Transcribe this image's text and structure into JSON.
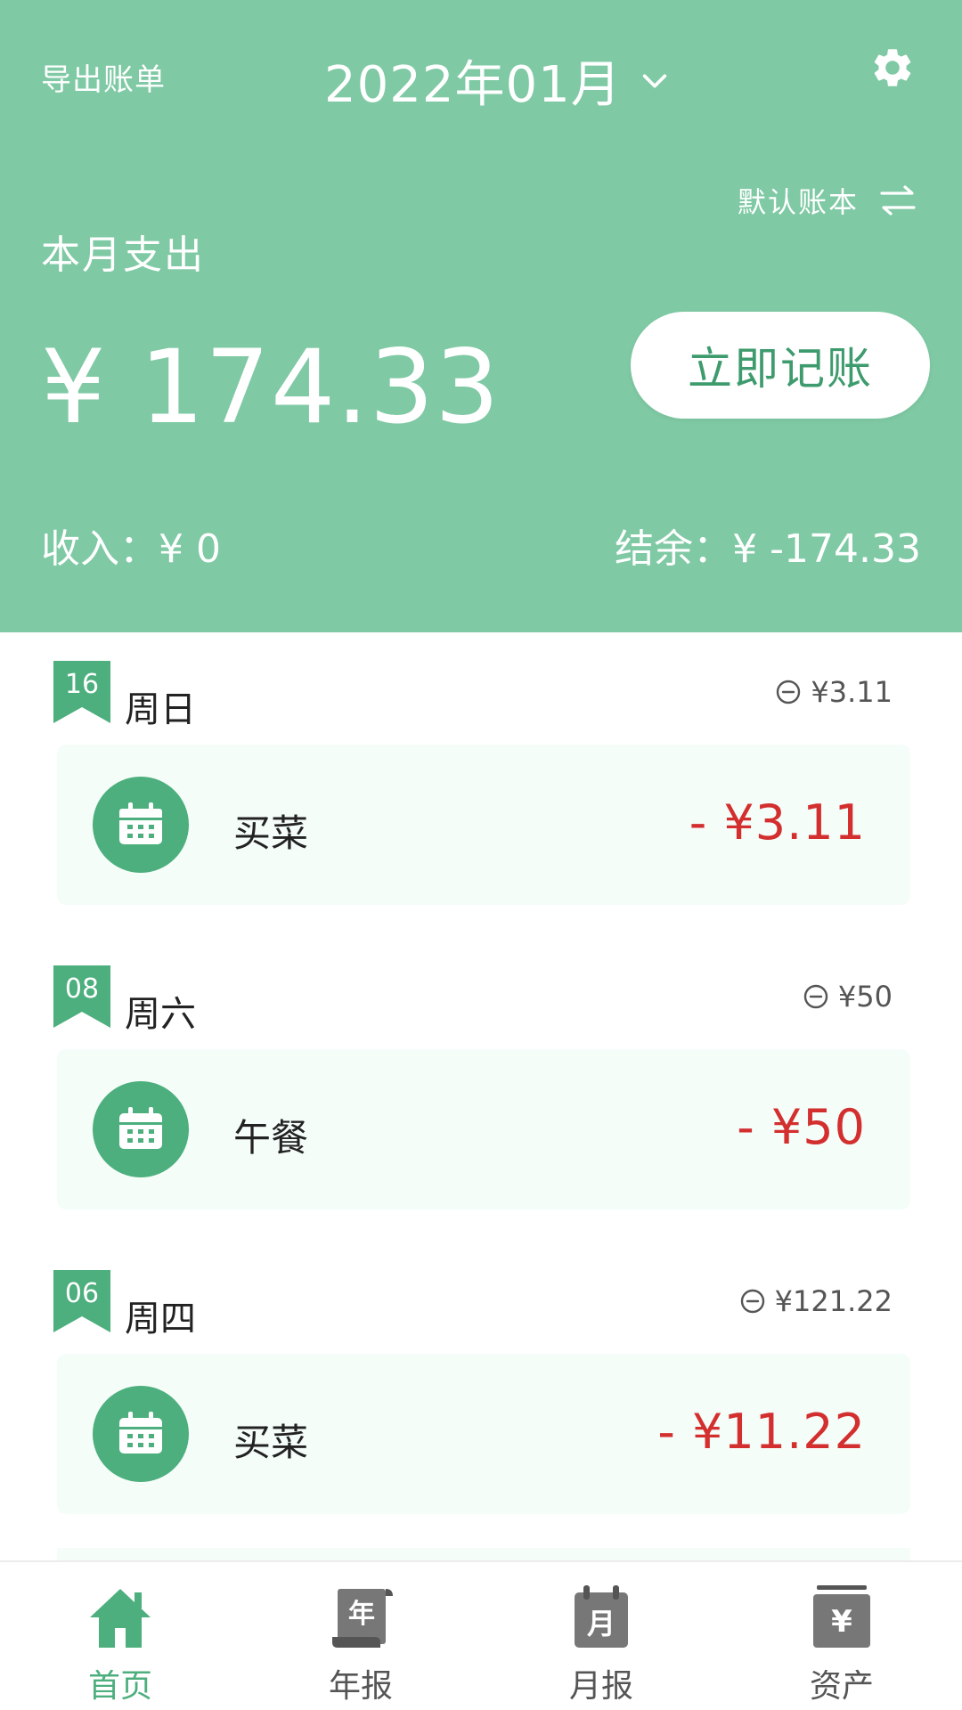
{
  "header": {
    "export_label": "导出账单",
    "month": "2022年01月",
    "book_label": "默认账本",
    "expense_label": "本月支出",
    "expense_amount": "¥ 174.33",
    "record_button": "立即记账",
    "income": "收入：¥ 0",
    "balance": "结余：¥ -174.33"
  },
  "days": [
    {
      "date": "16",
      "weekday": "周日",
      "total": "¥3.11",
      "entries": [
        {
          "name": "买菜",
          "amount": "- ¥3.11",
          "icon": "calendar-icon"
        }
      ]
    },
    {
      "date": "08",
      "weekday": "周六",
      "total": "¥50",
      "entries": [
        {
          "name": "午餐",
          "amount": "- ¥50",
          "icon": "calendar-icon"
        }
      ]
    },
    {
      "date": "06",
      "weekday": "周四",
      "total": "¥121.22",
      "entries": [
        {
          "name": "买菜",
          "amount": "- ¥11.22",
          "icon": "calendar-icon"
        }
      ]
    }
  ],
  "tabs": [
    {
      "label": "首页",
      "icon": "home-icon",
      "active": true
    },
    {
      "label": "年报",
      "icon": "year-report-icon",
      "active": false
    },
    {
      "label": "月报",
      "icon": "month-report-icon",
      "active": false
    },
    {
      "label": "资产",
      "icon": "assets-icon",
      "active": false
    }
  ],
  "colors": {
    "header_bg": "#7fc9a4",
    "accent": "#4caf7d",
    "record_text": "#3e9b6d",
    "expense_red": "#d32f2f",
    "card_bg": "#f5fdf9"
  }
}
